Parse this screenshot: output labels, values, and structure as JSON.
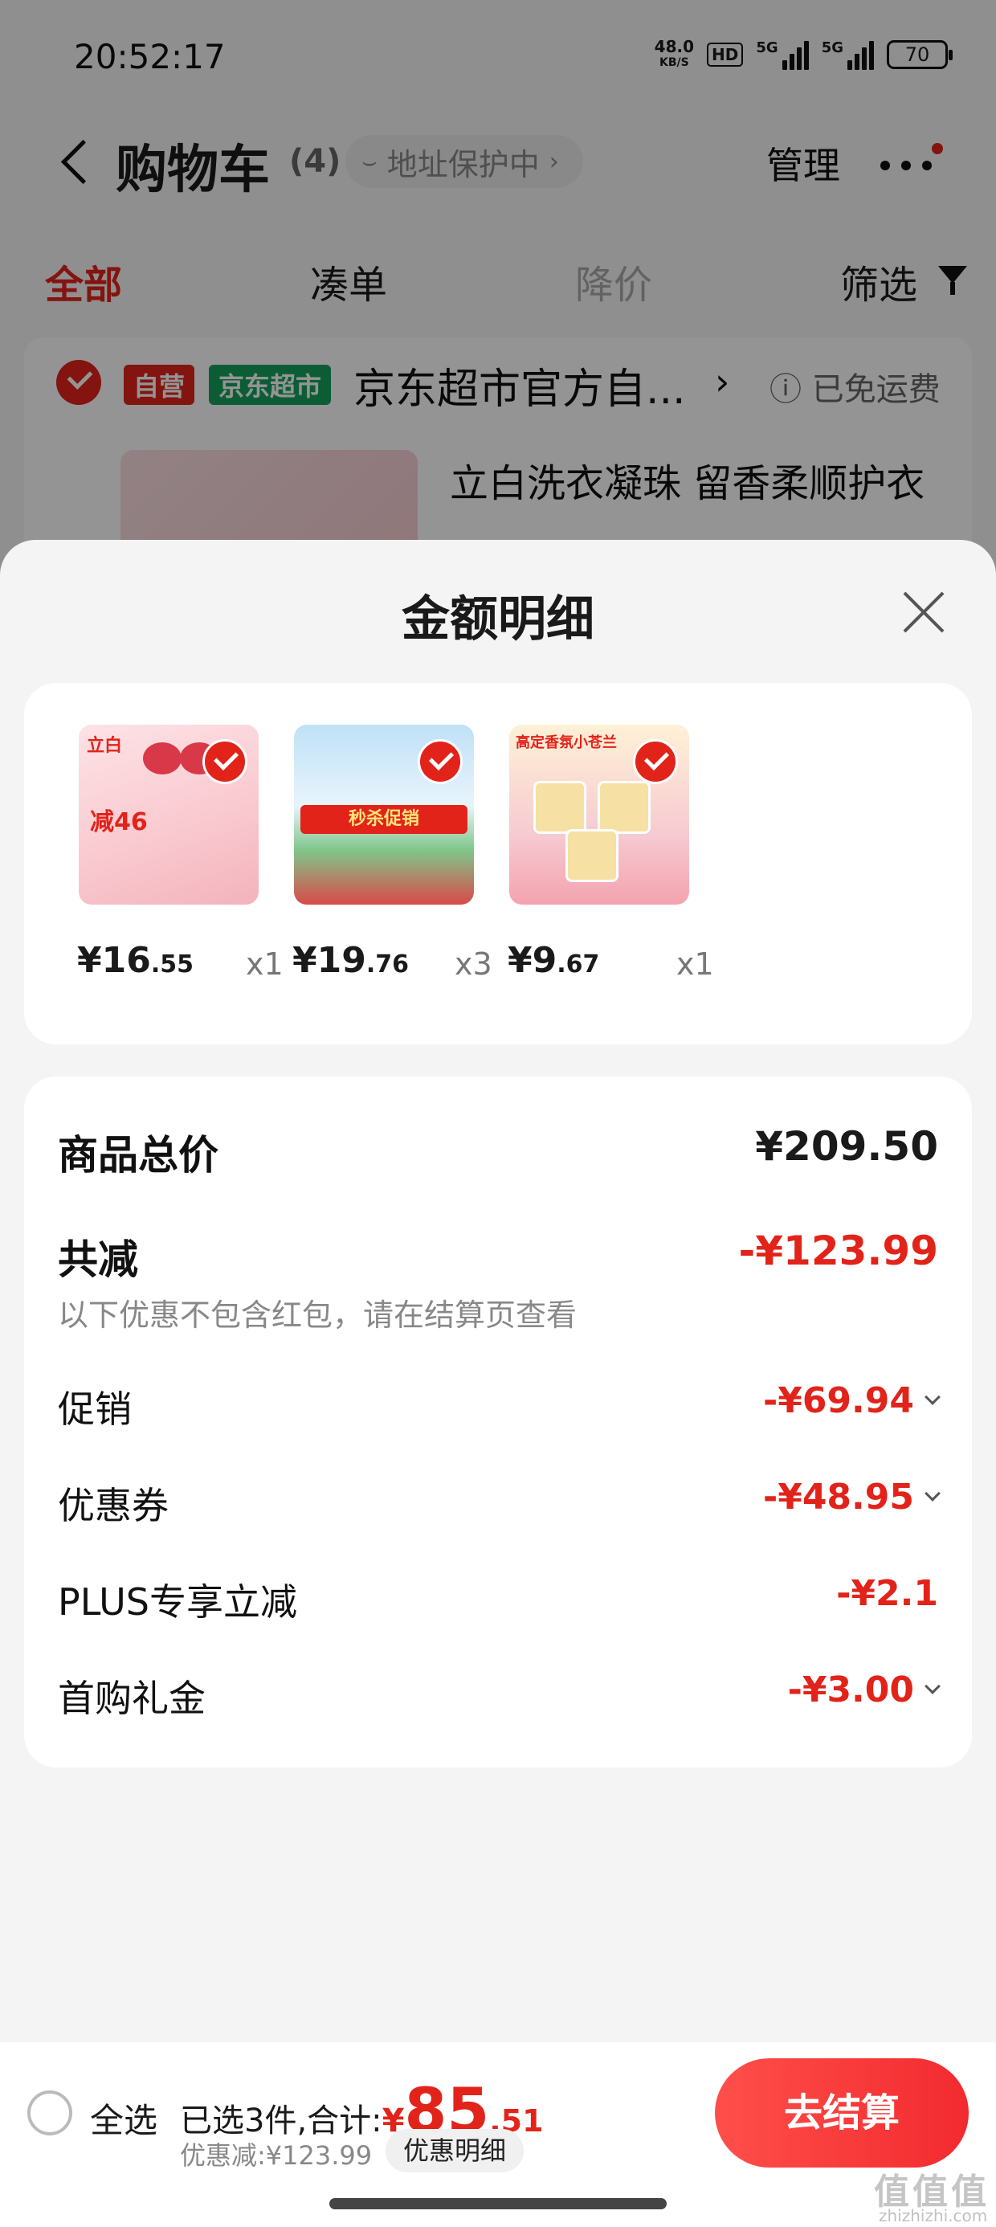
{
  "status_bar": {
    "time": "20:52:17",
    "net_speed_value": "48.0",
    "net_speed_unit": "KB/S",
    "hd_badge": "HD",
    "signal1_label": "5G",
    "signal2_label": "5G",
    "battery": "70"
  },
  "nav": {
    "title": "购物车",
    "count": "(4)",
    "address_protect": "地址保护中",
    "manage": "管理"
  },
  "tabs": [
    {
      "label": "全部",
      "state": "active"
    },
    {
      "label": "凑单",
      "state": "normal"
    },
    {
      "label": "降价",
      "state": "dim"
    },
    {
      "label": "筛选",
      "state": "normal"
    }
  ],
  "store": {
    "tag_self": "自营",
    "tag_market": "京东超市",
    "name": "京东超市官方自...",
    "shipping": "已免运费",
    "product_title": "立白洗衣凝珠 留香柔顺护衣"
  },
  "sheet": {
    "title": "金额明细",
    "products": [
      {
        "price_int": "¥16",
        "price_dec": ".55",
        "qty": "x1",
        "img_text": "减46"
      },
      {
        "price_int": "¥19",
        "price_dec": ".76",
        "qty": "x3",
        "img_text": "秒杀促销"
      },
      {
        "price_int": "¥9",
        "price_dec": ".67",
        "qty": "x1",
        "img_text": "高定香氛小苍兰"
      }
    ],
    "total_label": "商品总价",
    "total_value": "¥209.50",
    "reduce_label": "共减",
    "reduce_value": "-¥123.99",
    "reduce_note": "以下优惠不包含红包，请在结算页查看",
    "items": [
      {
        "label": "促销",
        "value": "-¥69.94",
        "expandable": true
      },
      {
        "label": "优惠券",
        "value": "-¥48.95",
        "expandable": true
      },
      {
        "label": "PLUS专享立减",
        "value": "-¥2.1",
        "expandable": false
      },
      {
        "label": "首购礼金",
        "value": "-¥3.00",
        "expandable": true
      }
    ]
  },
  "bottom": {
    "select_all": "全选",
    "selected_text": "已选3件,合计:",
    "total_yen": "¥",
    "total_int": "85",
    "total_dec": ".51",
    "discount_text": "优惠减:¥123.99",
    "detail_button": "优惠明细",
    "checkout_button": "去结算"
  },
  "watermark": {
    "text": "值值值",
    "sub": "zhizhizhi.com"
  },
  "colors": {
    "accent": "#e2231a",
    "market_green": "#16a05d"
  }
}
